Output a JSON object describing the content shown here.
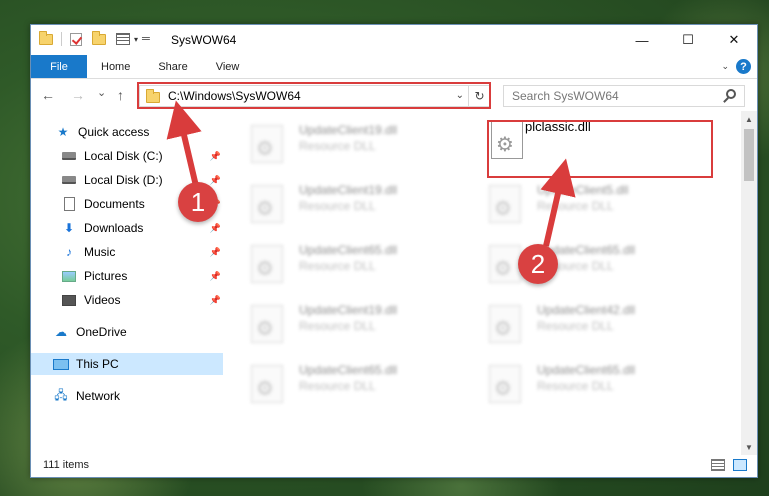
{
  "window": {
    "title": "SysWOW64",
    "controls": {
      "minimize": "—",
      "maximize": "☐",
      "close": "✕"
    }
  },
  "ribbon": {
    "tabs": [
      "File",
      "Home",
      "Share",
      "View"
    ],
    "help": "?"
  },
  "navigation": {
    "back": "←",
    "forward": "→",
    "recent": "⌄",
    "up": "↑",
    "address": "C:\\Windows\\SysWOW64",
    "refresh": "↻",
    "search_placeholder": "Search SysWOW64"
  },
  "sidebar": {
    "items": [
      {
        "label": "Quick access",
        "icon": "star-icon",
        "pinned": false
      },
      {
        "label": "Local Disk (C:)",
        "icon": "disk-icon",
        "pinned": true
      },
      {
        "label": "Local Disk (D:)",
        "icon": "disk-icon",
        "pinned": true
      },
      {
        "label": "Documents",
        "icon": "document-icon",
        "pinned": true
      },
      {
        "label": "Downloads",
        "icon": "download-icon",
        "pinned": true
      },
      {
        "label": "Music",
        "icon": "music-icon",
        "pinned": true
      },
      {
        "label": "Pictures",
        "icon": "pictures-icon",
        "pinned": true
      },
      {
        "label": "Videos",
        "icon": "videos-icon",
        "pinned": true
      },
      {
        "label": "OneDrive",
        "icon": "cloud-icon",
        "pinned": false
      },
      {
        "label": "This PC",
        "icon": "computer-icon",
        "pinned": false,
        "selected": true
      },
      {
        "label": "Network",
        "icon": "network-icon",
        "pinned": false
      }
    ]
  },
  "files": {
    "left_column": [
      {
        "name": "UpdateClient19.dll",
        "type": "Resource DLL"
      },
      {
        "name": "UpdateClient19.dll",
        "type": "Resource DLL"
      },
      {
        "name": "UpdateClient65.dll",
        "type": "Resource DLL"
      },
      {
        "name": "UpdateClient19.dll",
        "type": "Resource DLL"
      },
      {
        "name": "UpdateClient65.dll",
        "type": "Resource DLL"
      }
    ],
    "right_column": [
      {
        "name": "plclassic.dll",
        "type": ""
      },
      {
        "name": "UpdateClient5.dll",
        "type": "Resource DLL"
      },
      {
        "name": "UpdateClient65.dll",
        "type": "Resource DLL"
      },
      {
        "name": "UpdateClient42.dll",
        "type": "Resource DLL"
      },
      {
        "name": "UpdateClient65.dll",
        "type": "Resource DLL"
      }
    ]
  },
  "status": {
    "item_count": "111 items"
  },
  "annotations": {
    "step1": "1",
    "step2": "2",
    "color": "#d93c3c"
  }
}
